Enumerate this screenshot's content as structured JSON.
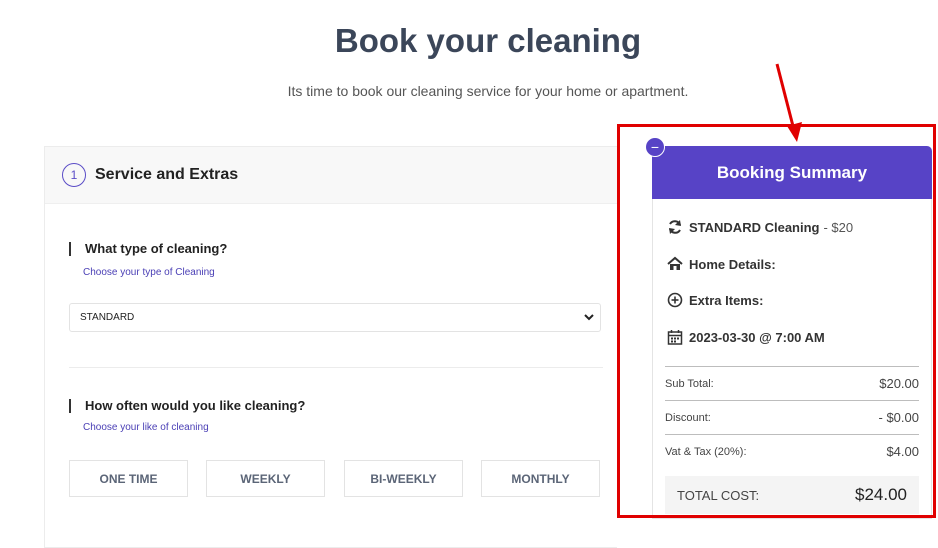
{
  "page": {
    "title": "Book your cleaning",
    "subtitle": "Its time to book our cleaning service for your home or apartment."
  },
  "step": {
    "number": "1",
    "title": "Service and Extras"
  },
  "cleaning_type": {
    "label": "What type of cleaning?",
    "hint": "Choose your type of Cleaning",
    "selected": "STANDARD"
  },
  "frequency": {
    "label": "How often would you like cleaning?",
    "hint": "Choose your like of cleaning",
    "options": [
      "ONE TIME",
      "WEEKLY",
      "BI-WEEKLY",
      "MONTHLY"
    ]
  },
  "summary": {
    "collapse_symbol": "−",
    "title": "Booking Summary",
    "service_name": "STANDARD Cleaning",
    "service_price": "- $20",
    "home_details": "Home Details:",
    "extra_items": "Extra Items:",
    "datetime": "2023-03-30 @ 7:00 AM",
    "subtotal_label": "Sub Total:",
    "subtotal_value": "$20.00",
    "discount_label": "Discount:",
    "discount_value": "- $0.00",
    "tax_label": "Vat & Tax (20%):",
    "tax_value": "$4.00",
    "total_label": "TOTAL COST:",
    "total_value": "$24.00"
  },
  "colors": {
    "accent": "#5743c6",
    "highlight": "#e00000",
    "title": "#3b4659"
  }
}
